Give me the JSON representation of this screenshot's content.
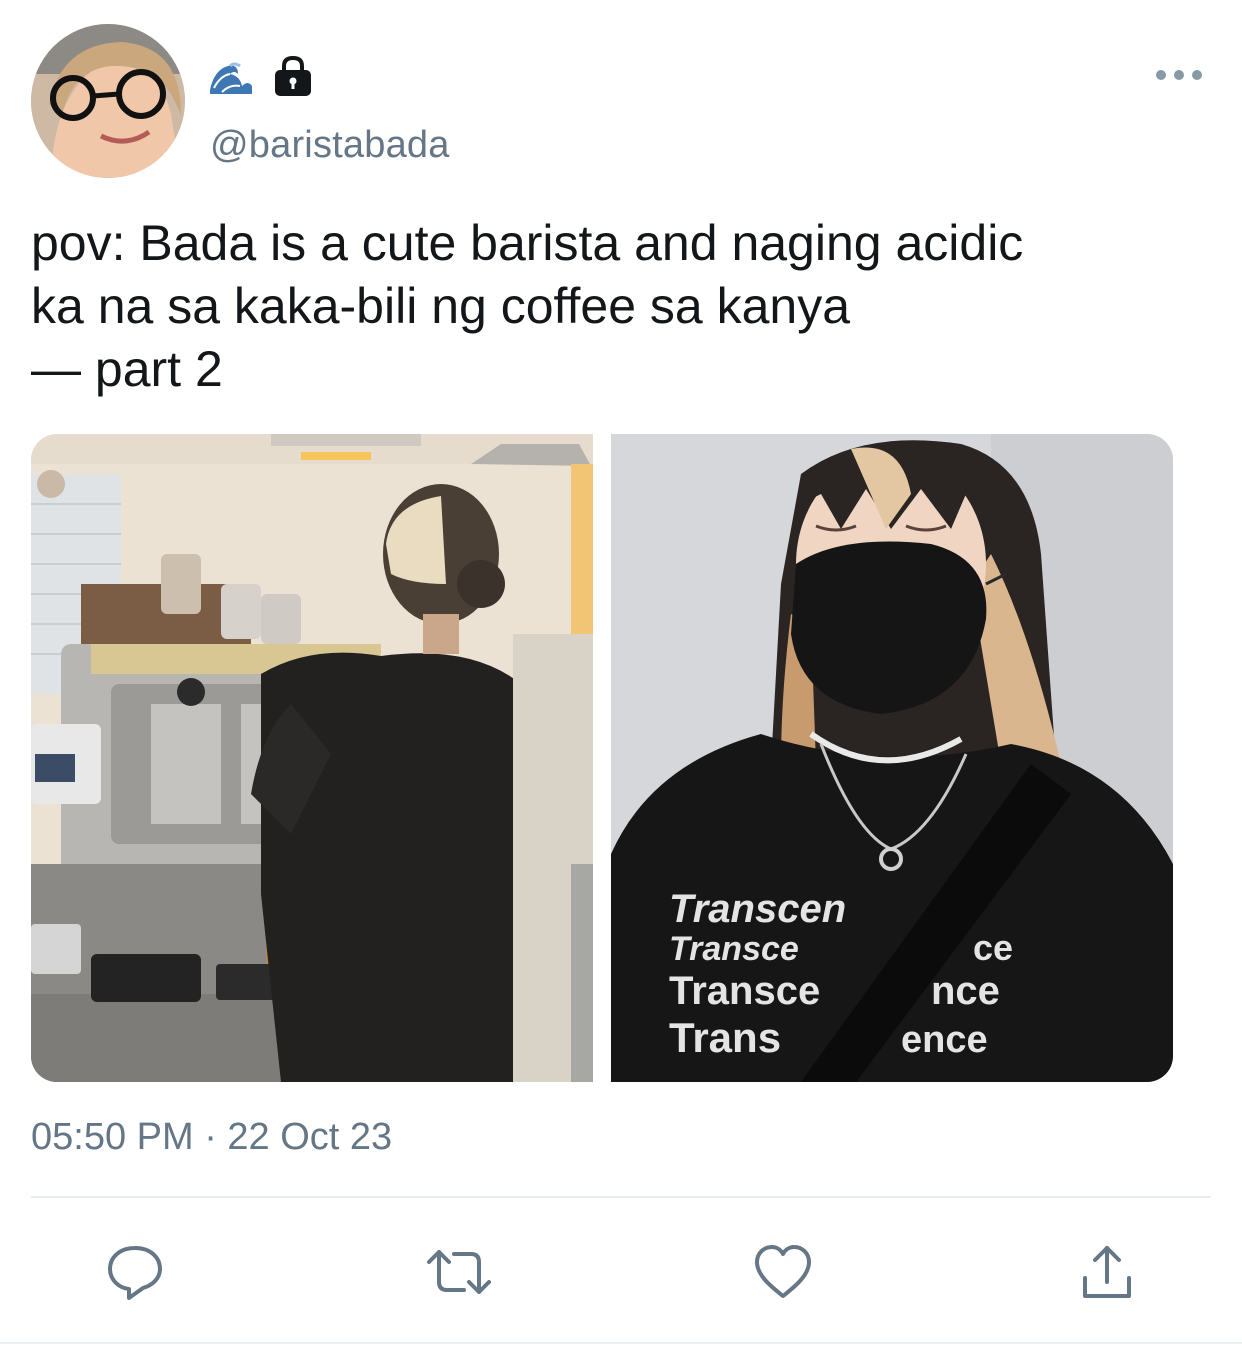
{
  "author": {
    "display_name_icons": [
      "water-wave-icon",
      "lock-icon"
    ],
    "handle": "@baristabada"
  },
  "tweet": {
    "text": "pov: Bada is a cute barista and naging acidic\nka na sa kaka-bili ng coffee sa kanya\n— part 2",
    "shirt_print": [
      "Transcen",
      "Transce",
      "ce",
      "Transce",
      "nce",
      "Trans",
      "ence"
    ],
    "timestamp": "05:50 PM · 22 Oct 23"
  },
  "actions": [
    "reply-icon",
    "retweet-icon",
    "like-icon",
    "share-icon"
  ],
  "colors": {
    "text": "#14171a",
    "secondary": "#657786",
    "icon": "#657786",
    "divider": "#e6ecf0"
  }
}
